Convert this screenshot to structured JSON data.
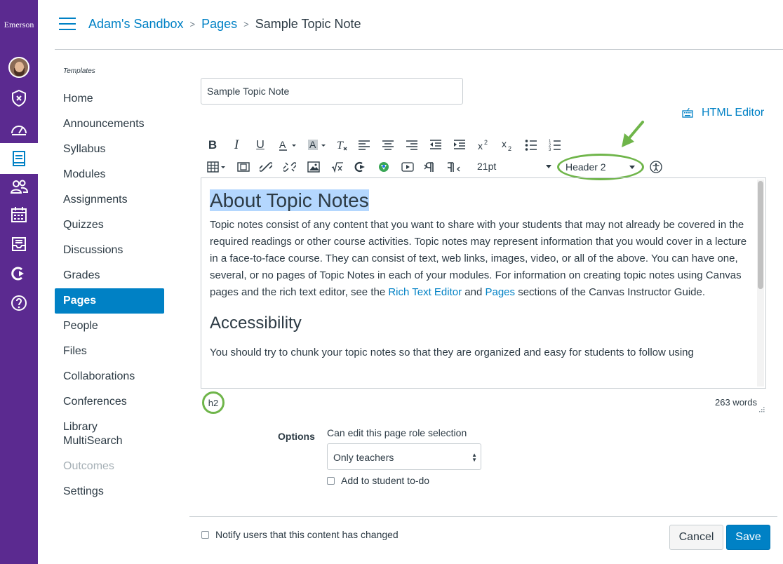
{
  "global_nav": {
    "logo_text": "Emerson",
    "bg_color": "#5b2a90",
    "items": [
      {
        "icon": "account-avatar-icon"
      },
      {
        "icon": "admin-shield-icon"
      },
      {
        "icon": "dashboard-gauge-icon"
      },
      {
        "icon": "courses-book-icon",
        "active": true
      },
      {
        "icon": "groups-people-icon"
      },
      {
        "icon": "calendar-icon"
      },
      {
        "icon": "inbox-icon"
      },
      {
        "icon": "commons-arrow-icon"
      },
      {
        "icon": "help-question-icon"
      }
    ]
  },
  "header": {
    "breadcrumb": [
      "Adam's Sandbox",
      "Pages",
      "Sample Topic Note"
    ]
  },
  "course_nav": {
    "section_label": "Templates",
    "items": [
      {
        "label": "Home"
      },
      {
        "label": "Announcements"
      },
      {
        "label": "Syllabus"
      },
      {
        "label": "Modules"
      },
      {
        "label": "Assignments"
      },
      {
        "label": "Quizzes"
      },
      {
        "label": "Discussions"
      },
      {
        "label": "Grades"
      },
      {
        "label": "Pages",
        "active": true
      },
      {
        "label": "People"
      },
      {
        "label": "Files"
      },
      {
        "label": "Collaborations"
      },
      {
        "label": "Conferences"
      },
      {
        "label": "Library\nMultiSearch"
      },
      {
        "label": "Outcomes",
        "disabled": true
      },
      {
        "label": "Settings"
      }
    ]
  },
  "editor": {
    "title_value": "Sample Topic Note",
    "html_editor_label": "HTML Editor",
    "font_size": "21pt",
    "block_format": "Header 2",
    "content": {
      "heading1": "About Topic Notes",
      "para1_before_link1": "Topic notes consist of any content that you want to share with your students that may not already be covered in the required readings or other course activities. Topic notes may represent information that you would cover in a lecture in a face-to-face course.  They can consist of text, web links, images, video, or all of the above. You can have one, several, or no pages of Topic Notes in each of your modules. For information on creating topic notes using Canvas pages and the rich text editor, see the ",
      "link1": "Rich Text Editor",
      "para1_between": " and ",
      "link2": "Pages",
      "para1_after": " sections of the Canvas Instructor Guide.",
      "heading2": "Accessibility",
      "para2": "You should try to chunk your topic notes so that they are organized and easy for students to follow using"
    },
    "status_path": "h2",
    "word_count": "263 words",
    "annotation_color": "#6fb54a"
  },
  "options": {
    "label": "Options",
    "role_label": "Can edit this page role selection",
    "role_value": "Only teachers",
    "todo_label": "Add to student to-do"
  },
  "footer": {
    "notify_label": "Notify users that this content has changed",
    "cancel_label": "Cancel",
    "save_label": "Save"
  },
  "colors": {
    "link": "#0081c5",
    "primary_button": "#0081c5",
    "text": "#2d3b45"
  }
}
